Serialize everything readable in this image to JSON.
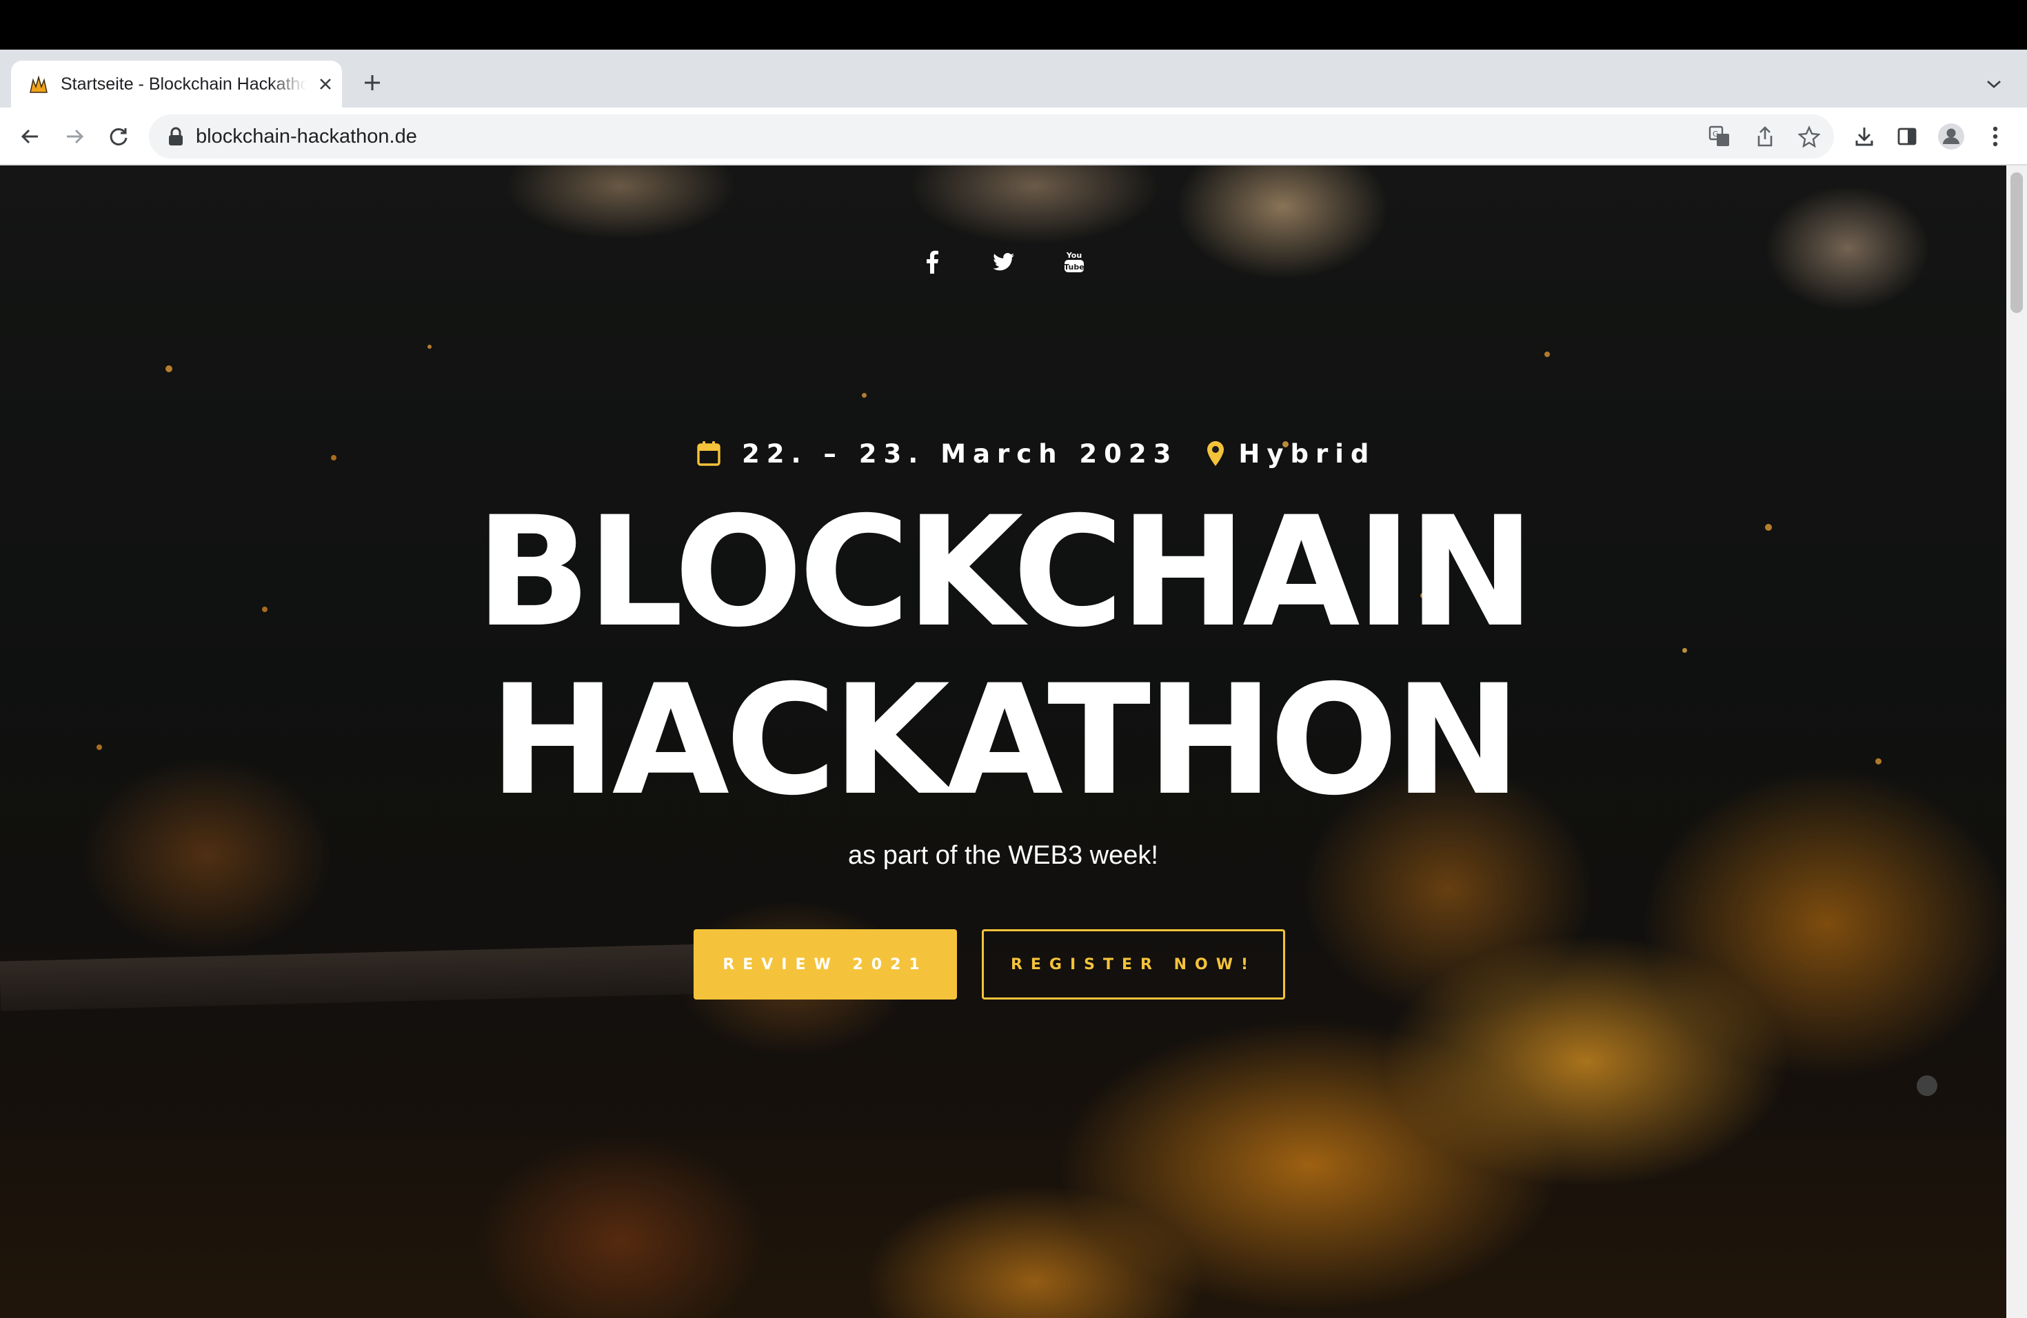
{
  "browser": {
    "tab": {
      "title": "Startseite - Blockchain Hackathon"
    },
    "address_bar": {
      "url": "blockchain-hackathon.de"
    }
  },
  "page": {
    "social_links": [
      {
        "icon": "facebook-icon"
      },
      {
        "icon": "twitter-icon"
      },
      {
        "icon": "youtube-icon"
      }
    ],
    "event": {
      "date": "22. – 23. March 2023",
      "location": "Hybrid"
    },
    "headline": {
      "line1": "BLOCKCHAIN",
      "line2": "HACKATHON"
    },
    "subtitle": "as part of the WEB3 week!",
    "buttons": {
      "review": "REVIEW 2021",
      "register": "REGISTER NOW!"
    },
    "colors": {
      "accent": "#f5c33b",
      "text": "#ffffff"
    }
  }
}
